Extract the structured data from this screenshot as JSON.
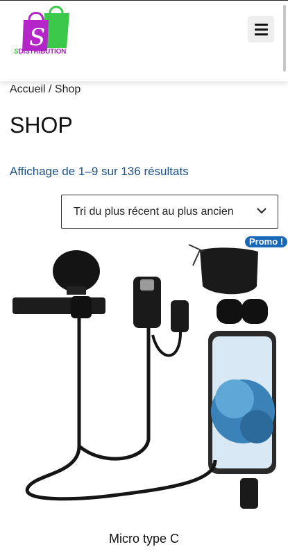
{
  "header": {
    "logo_text": "DISTRIBUTION",
    "logo_letter": "S",
    "menu_icon": "hamburger-icon"
  },
  "breadcrumb": {
    "home": "Accueil",
    "separator": " / ",
    "current": "Shop"
  },
  "page": {
    "title": "SHOP",
    "result_count": "Affichage de 1–9 sur 136 résultats"
  },
  "sort": {
    "selected": "Tri du plus récent au plus ancien"
  },
  "product": {
    "badge": "Promo !",
    "name": "Micro type C"
  },
  "colors": {
    "accent_blue": "#1867b9",
    "link_blue": "#1b4f86",
    "logo_purple": "#a51fbf",
    "logo_green": "#3cc84a"
  }
}
